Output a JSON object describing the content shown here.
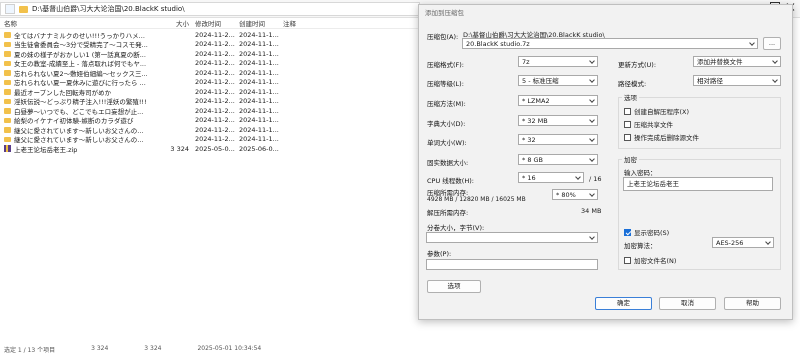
{
  "fm": {
    "path": "D:\\基督山伯爵\\习大大论治国\\20.BlackK studio\\",
    "headers": {
      "name": "名称",
      "size": "大小",
      "modified": "修改时间",
      "created": "创建时间",
      "note": "注释"
    },
    "rows": [
      {
        "name": "全てはバナナミルクのせい!!!うっかりハメ...",
        "size": "",
        "modified": "2024-11-2...",
        "created": "2024-11-1...",
        "type": "folder"
      },
      {
        "name": "当生徒會委員会～3分で受精完了～コスモ発...",
        "size": "",
        "modified": "2024-11-2...",
        "created": "2024-11-1...",
        "type": "folder"
      },
      {
        "name": "夏の妹の様子がおかしい1 (第一話真夏の断...",
        "size": "",
        "modified": "2024-11-2...",
        "created": "2024-11-1...",
        "type": "folder"
      },
      {
        "name": "女王の教室-成績至上 - 落点取れば何でもヤ...",
        "size": "",
        "modified": "2024-11-2...",
        "created": "2024-11-1...",
        "type": "folder"
      },
      {
        "name": "忘れられない夏2～敷姪伯細編～セックス三...",
        "size": "",
        "modified": "2024-11-2...",
        "created": "2024-11-1...",
        "type": "folder"
      },
      {
        "name": "忘れられない夏一夏休みに遊びに行ったら ...",
        "size": "",
        "modified": "2024-11-2...",
        "created": "2024-11-1...",
        "type": "folder"
      },
      {
        "name": "最近オープンした回転寿司がめか",
        "size": "",
        "modified": "2024-11-2...",
        "created": "2024-11-1...",
        "type": "folder"
      },
      {
        "name": "淫妖伝説～どっぷり精子注入!!!淫妖の繁殖!!!",
        "size": "",
        "modified": "2024-11-2...",
        "created": "2024-11-1...",
        "type": "folder"
      },
      {
        "name": "白昼夢～いつでも、どこでもエロ妄想が止...",
        "size": "",
        "modified": "2024-11-2...",
        "created": "2024-11-1...",
        "type": "folder"
      },
      {
        "name": "絵梨のイケナイ初体験-嫉断のカラダ遊び",
        "size": "",
        "modified": "2024-11-2...",
        "created": "2024-11-1...",
        "type": "folder"
      },
      {
        "name": "継父に愛されています～新しいお父さんの...",
        "size": "",
        "modified": "2024-11-2...",
        "created": "2024-11-1...",
        "type": "folder"
      },
      {
        "name": "継父に愛されています～新しいお父さんの...",
        "size": "",
        "modified": "2024-11-2...",
        "created": "2024-11-1...",
        "type": "folder"
      },
      {
        "name": "上老王论坛岳老王.zip",
        "size": "3 324",
        "modified": "2025-05-0...",
        "created": "2025-06-0...",
        "type": "zip"
      }
    ],
    "status": [
      "选定 1 / 13 个项目",
      "3 324",
      "3 324",
      "2025-05-01 10:34:54"
    ]
  },
  "dialog": {
    "title": "添加到压缩包",
    "archive_label": "压缩包(A):",
    "archive_dir": "D:\\基督山伯爵\\习大大论治国\\20.BlackK studio\\",
    "archive_name": "20.BlackK studio.7z",
    "browse": "...",
    "format_label": "压缩格式(F):",
    "format_value": "7z",
    "level_label": "压缩等级(L):",
    "level_value": "5 - 标准压缩",
    "method_label": "压缩方法(M):",
    "method_value": "* LZMA2",
    "dict_label": "字典大小(D):",
    "dict_value": "* 32 MB",
    "word_label": "单词大小(W):",
    "word_value": "* 32",
    "solid_label": "固实数据大小:",
    "solid_value": "* 8 GB",
    "cpu_label": "CPU 线程数(H):",
    "cpu_value": "* 16",
    "cpu_total": "/ 16",
    "mem_label": "压缩所需内存:",
    "mem_detail": "4928 MB / 12820 MB / 16025 MB",
    "mem_value": "* 80%",
    "decomp_label": "解压所需内存:",
    "decomp_value": "34 MB",
    "split_label": "分卷大小，字节(V):",
    "param_label": "参数(P):",
    "options_btn": "选项",
    "update_label": "更新方式(U):",
    "update_value": "添加并替换文件",
    "pathmode_label": "路径模式:",
    "pathmode_value": "相对路径",
    "options_group": "选项",
    "opt_sfx": "创建自解压程序(X)",
    "opt_shared": "压缩共享文件",
    "opt_delete": "操作完成后删除源文件",
    "enc_group": "加密",
    "pwd_label": "输入密码：",
    "pwd_value": "上老王论坛岳老王",
    "show_pwd": "显示密码(S)",
    "enc_method_label": "加密算法：",
    "enc_method_value": "AES-256",
    "enc_names": "加密文件名(N)",
    "ok": "确定",
    "cancel": "取消",
    "help": "帮助"
  }
}
